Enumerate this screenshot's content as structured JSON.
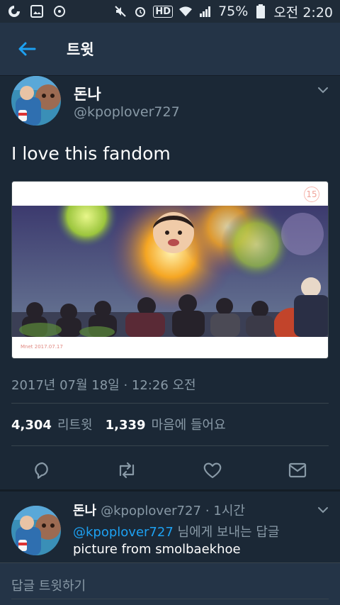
{
  "status_bar": {
    "battery": "75%",
    "time": "오전 2:20",
    "hd": "HD"
  },
  "header": {
    "title": "트윗"
  },
  "tweet": {
    "display_name": "돈나",
    "handle": "@kpoplover727",
    "text": "I love this fandom",
    "media_badge": "15",
    "timestamp": "2017년 07월 18일 · 12:26 오전",
    "retweets": "4,304",
    "retweets_label": "리트윗",
    "likes": "1,339",
    "likes_label": "마음에 들어요"
  },
  "reply": {
    "display_name": "돈나",
    "handle": "@kpoplover727",
    "time": "· 1시간",
    "mention": "@kpoplover727",
    "to_label": "님에게 보내는 답글",
    "text": "picture from smolbaekhoe"
  },
  "compose": {
    "placeholder": "답글 트윗하기"
  },
  "colors": {
    "background": "#1b2836",
    "header": "#243447",
    "accent": "#1da1f2",
    "muted": "#8899a6"
  },
  "icons": [
    "back-arrow-icon",
    "chevron-down-icon",
    "reply-icon",
    "retweet-icon",
    "like-icon",
    "message-icon"
  ]
}
